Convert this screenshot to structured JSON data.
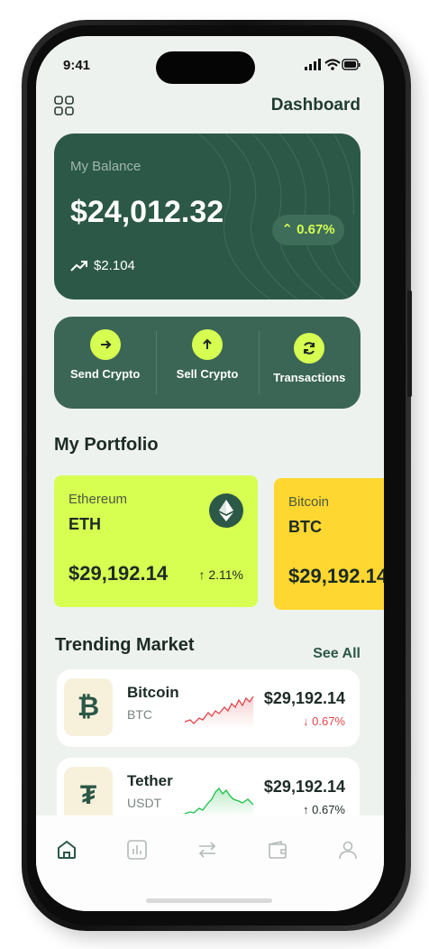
{
  "status": {
    "time": "9:41"
  },
  "header": {
    "title": "Dashboard",
    "menu_icon": "grid-icon"
  },
  "balance": {
    "label": "My Balance",
    "amount": "$24,012.32",
    "change_percent": "0.67%",
    "trend_value": "$2.104"
  },
  "actions": [
    {
      "label": "Send Crypto",
      "icon": "arrow-right-icon"
    },
    {
      "label": "Sell Crypto",
      "icon": "arrow-up-icon"
    },
    {
      "label": "Transactions",
      "icon": "refresh-icon"
    }
  ],
  "portfolio": {
    "title": "My Portfolio",
    "cards": [
      {
        "name": "Ethereum",
        "symbol": "ETH",
        "price": "$29,192.14",
        "change": "2.11%",
        "color": "#d6ff52"
      },
      {
        "name": "Bitcoin",
        "symbol": "BTC",
        "price": "$29,192.14",
        "color": "#ffd730"
      }
    ]
  },
  "market": {
    "title": "Trending Market",
    "see_all": "See All",
    "items": [
      {
        "name": "Bitcoin",
        "symbol": "BTC",
        "price": "$29,192.14",
        "change": "0.67%",
        "direction": "down",
        "logo": "₿"
      },
      {
        "name": "Tether",
        "symbol": "USDT",
        "price": "$29,192.14",
        "change": "0.67%",
        "direction": "up",
        "logo": "₮"
      }
    ]
  },
  "tabs": [
    {
      "icon": "home-icon",
      "active": true
    },
    {
      "icon": "chart-icon",
      "active": false
    },
    {
      "icon": "swap-icon",
      "active": false
    },
    {
      "icon": "wallet-icon",
      "active": false
    },
    {
      "icon": "profile-icon",
      "active": false
    }
  ],
  "colors": {
    "primary": "#2c5847",
    "accent": "#d6ff52",
    "down": "#e0464b",
    "up": "#1b8a3e"
  }
}
